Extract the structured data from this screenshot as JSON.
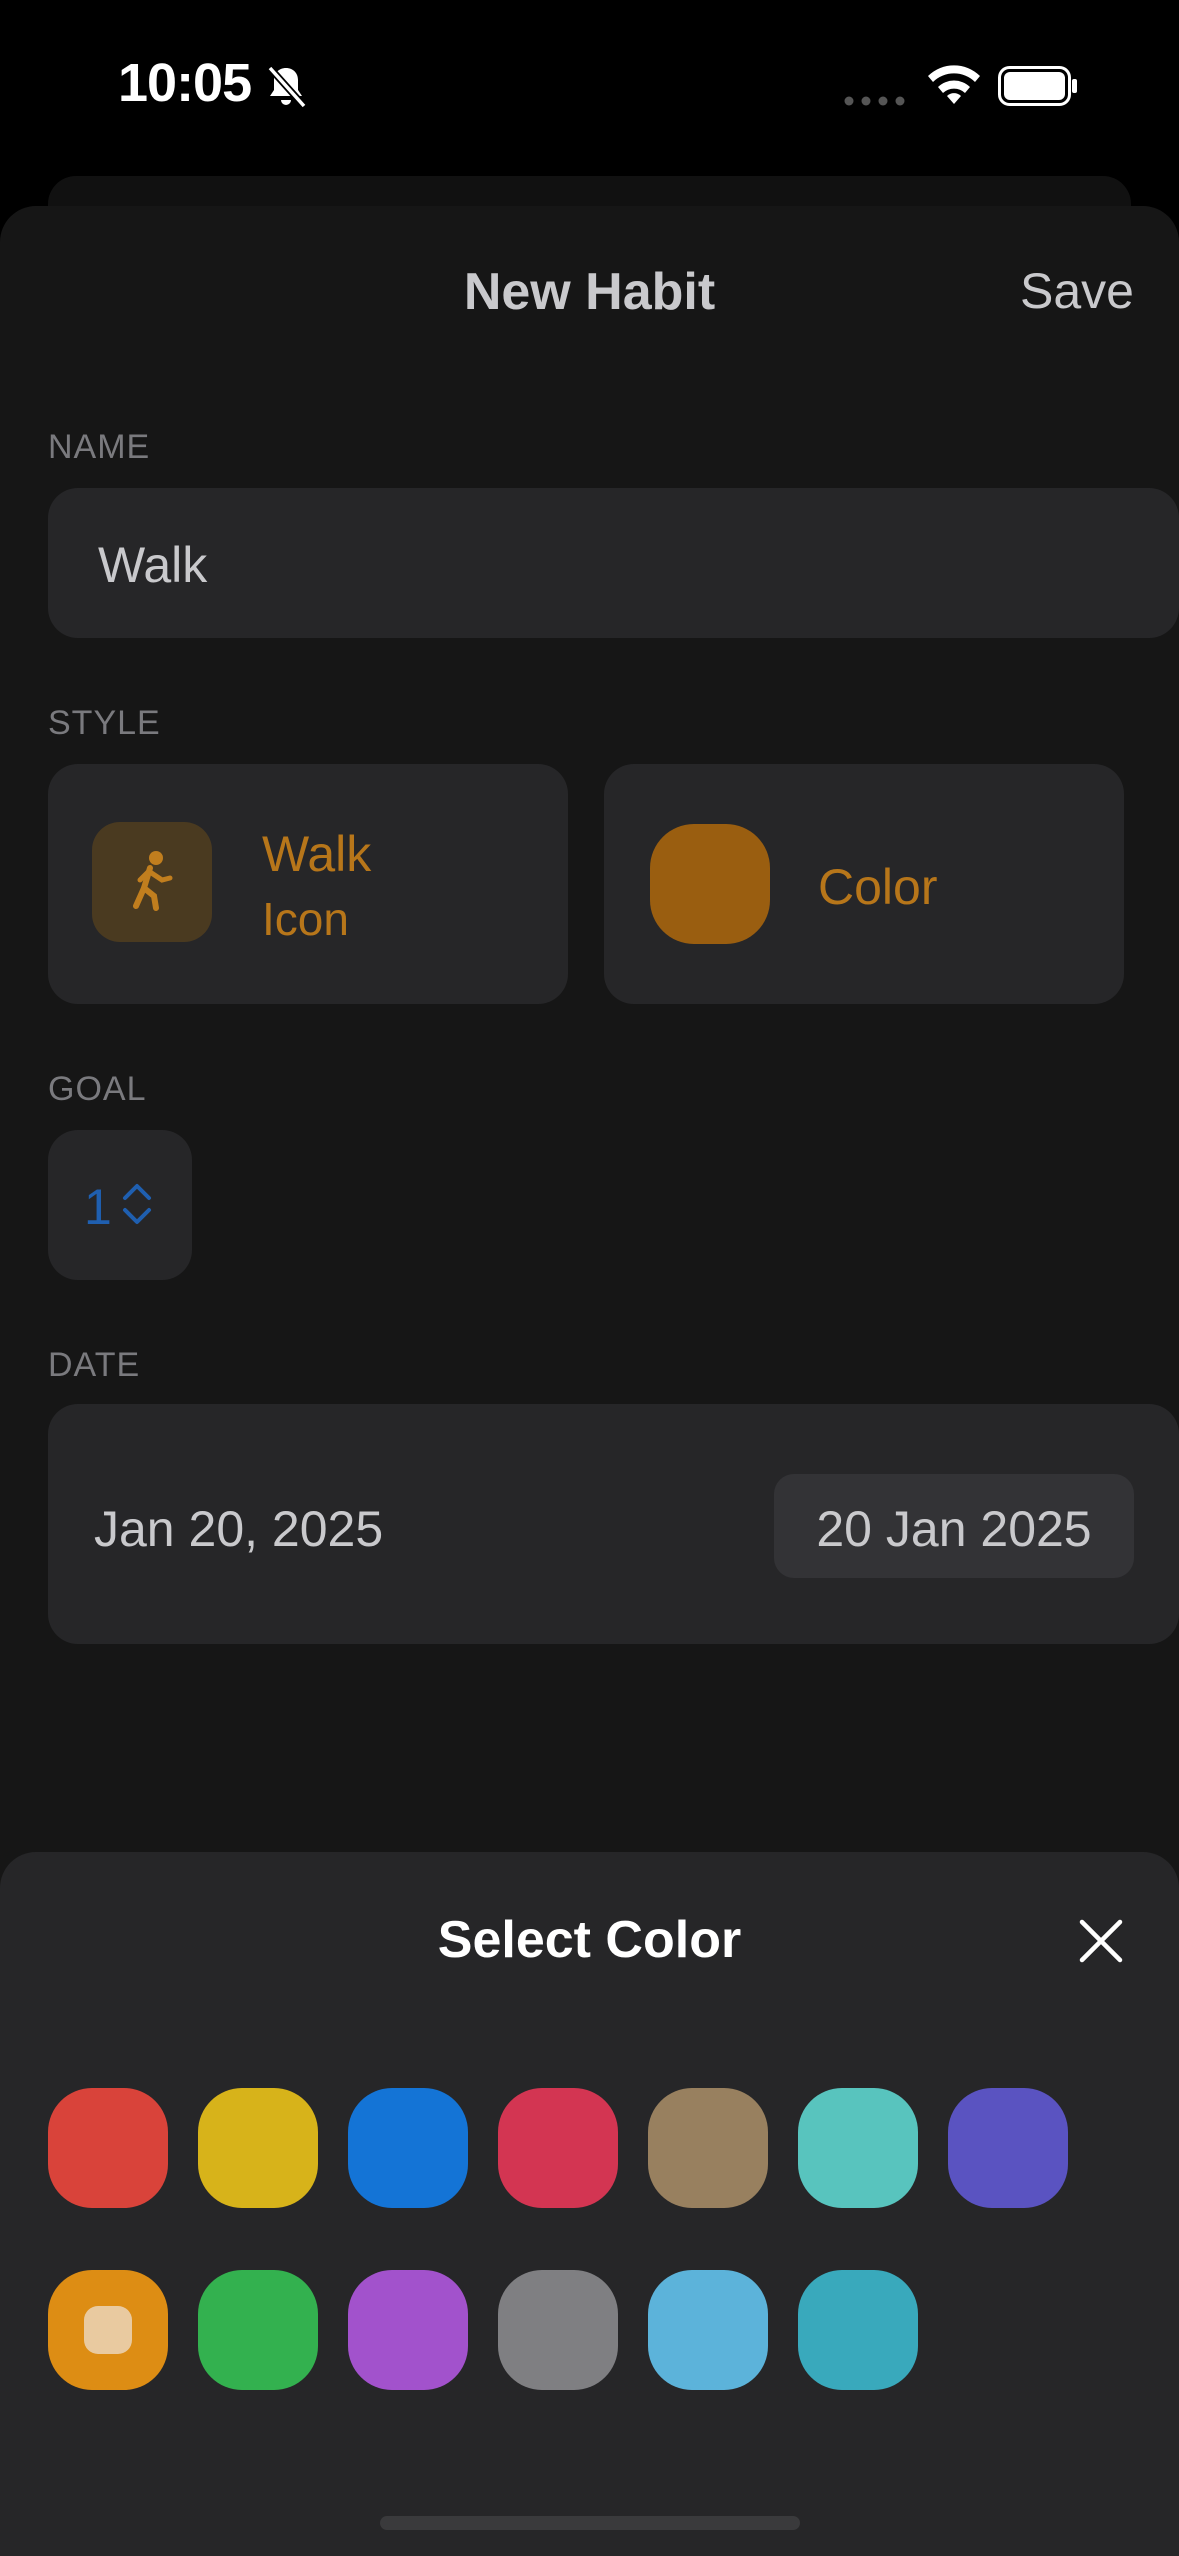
{
  "status_bar": {
    "time": "10:05"
  },
  "header": {
    "title": "New Habit",
    "save_label": "Save"
  },
  "name_section": {
    "label": "NAME",
    "value": "Walk"
  },
  "style_section": {
    "label": "STYLE",
    "icon_name": "Walk",
    "icon_sublabel": "Icon",
    "icon": "walk-icon",
    "color_label": "Color",
    "selected_color": "#9a5e10",
    "accent_color": "#b7761a"
  },
  "goal_section": {
    "label": "GOAL",
    "value": "1"
  },
  "date_section": {
    "label": "DATE",
    "date_text": "Jan 20, 2025",
    "picker_value": "20 Jan 2025"
  },
  "color_picker": {
    "title": "Select Color",
    "colors_row1": [
      "#d9433a",
      "#d7b31a",
      "#1474d6",
      "#d33552",
      "#98805f",
      "#58c4be",
      "#5a53c1"
    ],
    "colors_row2": [
      "#dd8d14",
      "#33b14f",
      "#a252cc",
      "#7f7f82",
      "#5cb3da",
      "#39a9bc"
    ],
    "selected_index": 7
  }
}
